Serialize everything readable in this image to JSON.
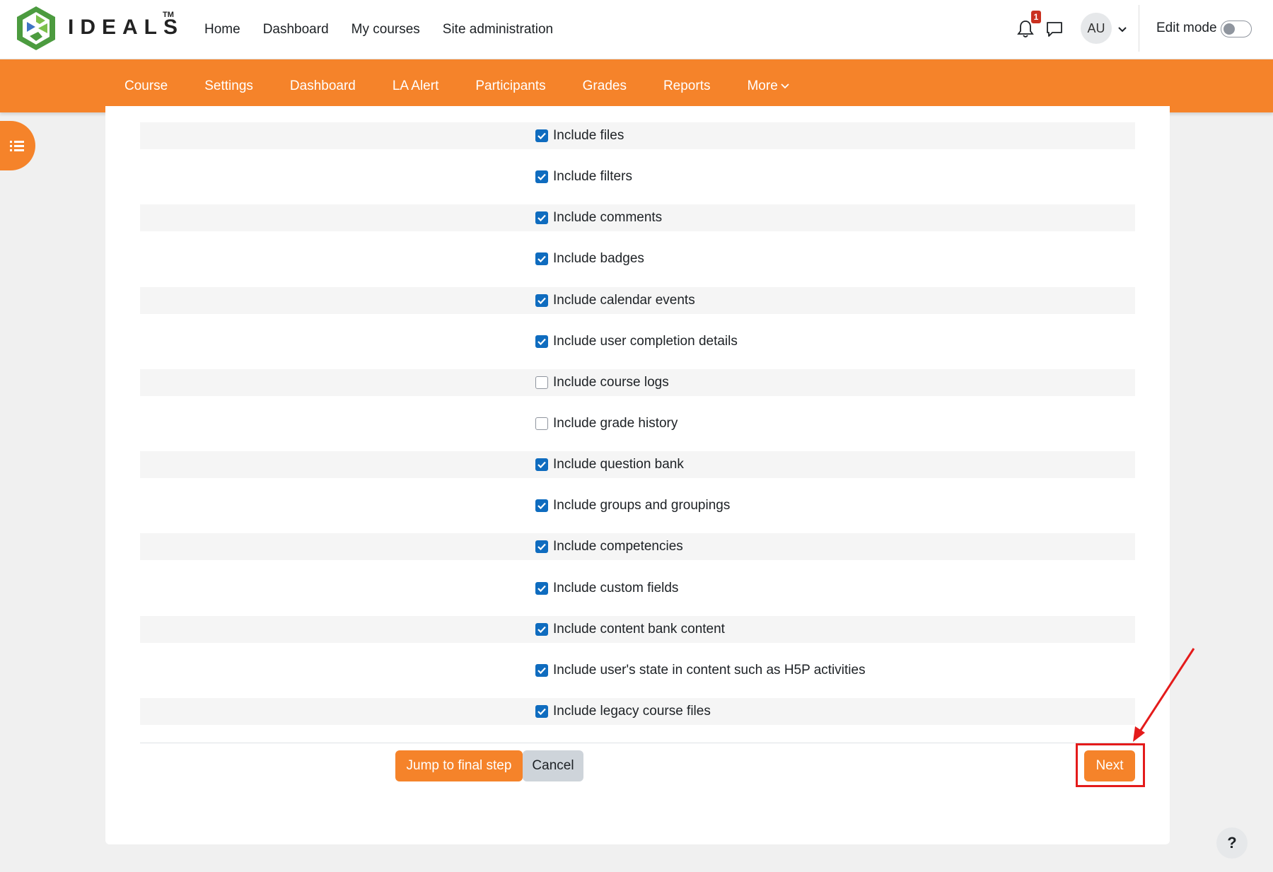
{
  "brand": {
    "name": "IDEALS",
    "trademark": "TM"
  },
  "primary_nav": [
    "Home",
    "Dashboard",
    "My courses",
    "Site administration"
  ],
  "notifications": {
    "count": "1"
  },
  "user": {
    "initials": "AU"
  },
  "edit_mode": {
    "label": "Edit mode",
    "enabled": false
  },
  "secondary_nav": [
    "Course",
    "Settings",
    "Dashboard",
    "LA Alert",
    "Participants",
    "Grades",
    "Reports",
    "More"
  ],
  "options": [
    {
      "label": "Include files",
      "checked": true
    },
    {
      "label": "Include filters",
      "checked": true
    },
    {
      "label": "Include comments",
      "checked": true
    },
    {
      "label": "Include badges",
      "checked": true
    },
    {
      "label": "Include calendar events",
      "checked": true
    },
    {
      "label": "Include user completion details",
      "checked": true
    },
    {
      "label": "Include course logs",
      "checked": false
    },
    {
      "label": "Include grade history",
      "checked": false
    },
    {
      "label": "Include question bank",
      "checked": true
    },
    {
      "label": "Include groups and groupings",
      "checked": true
    },
    {
      "label": "Include competencies",
      "checked": true
    },
    {
      "label": "Include custom fields",
      "checked": true
    },
    {
      "label": "Include content bank content",
      "checked": true
    },
    {
      "label": "Include user's state in content such as H5P activities",
      "checked": true
    },
    {
      "label": "Include legacy course files",
      "checked": true
    }
  ],
  "buttons": {
    "jump": "Jump to final step",
    "cancel": "Cancel",
    "next": "Next"
  },
  "help": {
    "label": "?"
  },
  "colors": {
    "accent": "#f5832a",
    "checkbox": "#0f6cbf",
    "annotation": "#e41b1b"
  }
}
